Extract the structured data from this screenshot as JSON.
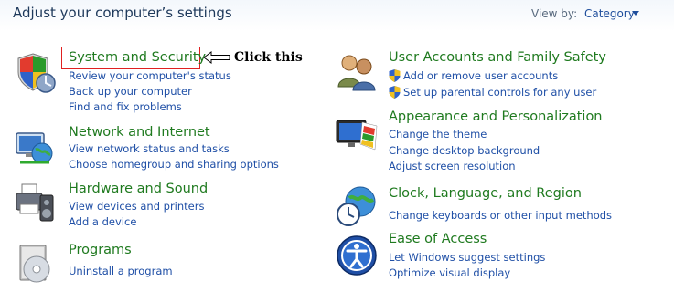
{
  "header": {
    "title": "Adjust your computer’s settings",
    "view_by_label": "View by:",
    "view_by_value": "Category"
  },
  "annotation": {
    "callout_text": "Click this"
  },
  "categories": [
    {
      "title": "System and Security",
      "icon": "shield-security-icon",
      "links": [
        "Review your computer's status",
        "Back up your computer",
        "Find and fix problems"
      ]
    },
    {
      "title": "Network and Internet",
      "icon": "network-globe-icon",
      "links": [
        "View network status and tasks",
        "Choose homegroup and sharing options"
      ]
    },
    {
      "title": "Hardware and Sound",
      "icon": "printer-speaker-icon",
      "links": [
        "View devices and printers",
        "Add a device"
      ]
    },
    {
      "title": "Programs",
      "icon": "programs-disc-icon",
      "links": [
        "Uninstall a program"
      ]
    },
    {
      "title": "User Accounts and Family Safety",
      "icon": "users-icon",
      "links": [
        "Add or remove user accounts",
        "Set up parental controls for any user"
      ]
    },
    {
      "title": "Appearance and Personalization",
      "icon": "monitor-paint-icon",
      "links": [
        "Change the theme",
        "Change desktop background",
        "Adjust screen resolution"
      ]
    },
    {
      "title": "Clock, Language, and Region",
      "icon": "clock-globe-icon",
      "links": [
        "Change keyboards or other input methods"
      ]
    },
    {
      "title": "Ease of Access",
      "icon": "ease-of-access-icon",
      "links": [
        "Let Windows suggest settings",
        "Optimize visual display"
      ]
    }
  ],
  "colors": {
    "category_title": "#1f7a1f",
    "link": "#1f4fa6",
    "highlight_border": "#e02020"
  }
}
